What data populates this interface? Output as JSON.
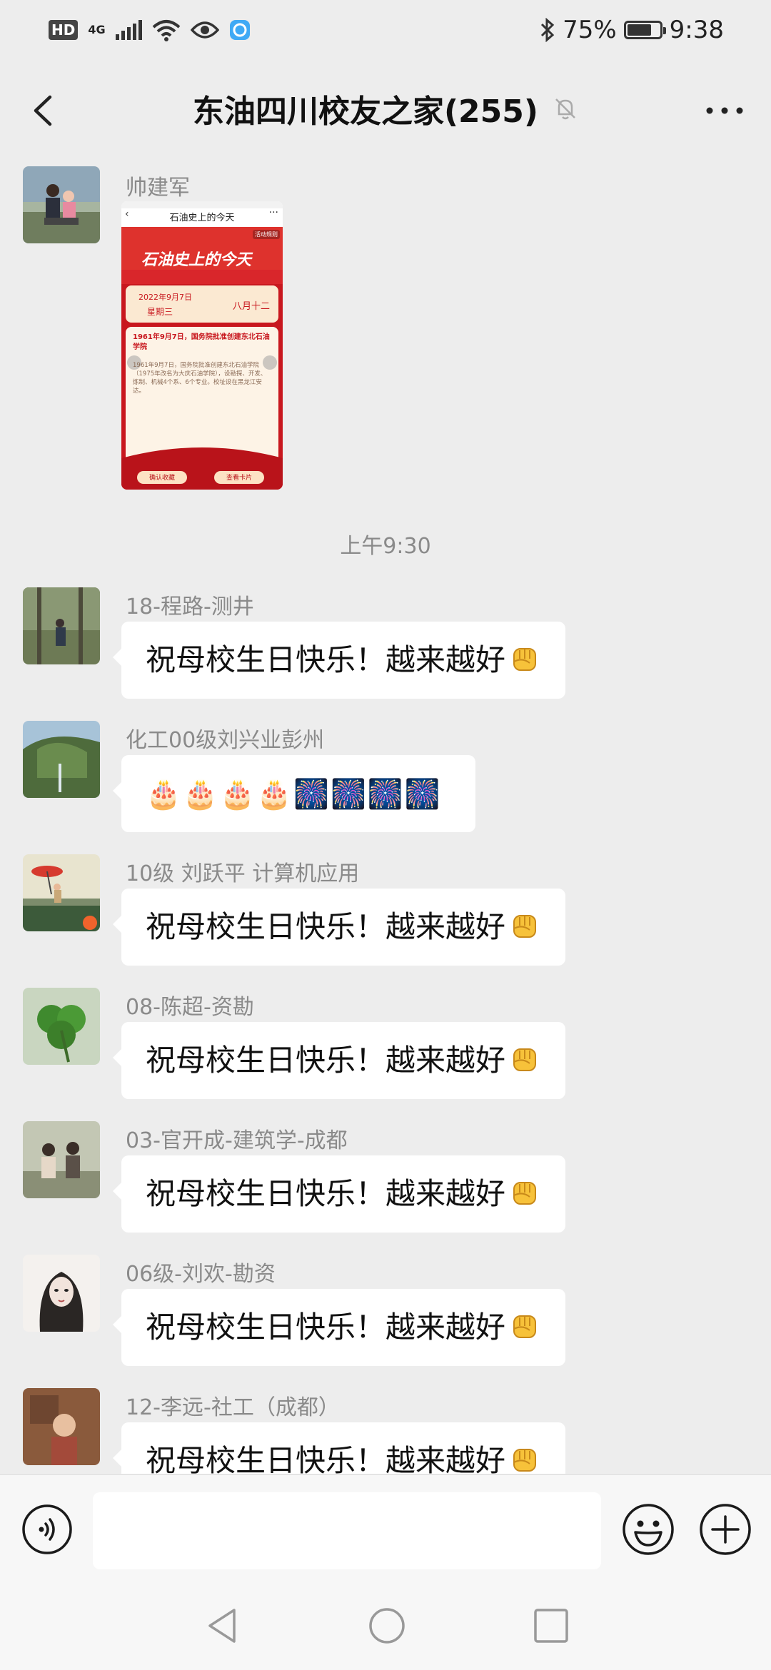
{
  "status_bar": {
    "hd": "HD",
    "network": "4G",
    "battery_percent": "75%",
    "battery_level": 0.75,
    "time": "9:38",
    "icons": [
      "hd-icon",
      "signal-icon",
      "wifi-icon",
      "eye-icon",
      "app-icon",
      "bluetooth-icon",
      "battery-icon"
    ]
  },
  "header": {
    "title": "东油四川校友之家(255)",
    "icons": [
      "back-icon",
      "mute-bell-icon",
      "more-icon"
    ]
  },
  "image_card": {
    "header_title": "石油史上的今天",
    "banner_title": "石油史上的今天",
    "tag": "活动规则",
    "date": "2022年9月7日",
    "weekday": "星期三",
    "lunar": "八月十二",
    "headline": "1961年9月7日，国务院批准创建东北石油学院",
    "body": "1961年9月7日，国务院批准创建东北石油学院（1975年改名为大庆石油学院），设勘探、开发、炼制、机械4个系、6个专业。校址设在黑龙江安达。",
    "button_left": "确认收藏",
    "button_right": "查看卡片"
  },
  "chat": {
    "first_sender": "帅建军",
    "time_divider": "上午9:30",
    "messages": [
      {
        "sender": "18-程路-测井",
        "text": "祝母校生日快乐！越来越好",
        "emoji": "fist-icon"
      },
      {
        "sender": "化工00级刘兴业彭州",
        "text": "🎂🎂🎂🎂🎆🎆🎆🎆"
      },
      {
        "sender": "10级 刘跃平 计算机应用",
        "text": "祝母校生日快乐！越来越好",
        "emoji": "fist-icon"
      },
      {
        "sender": "08-陈超-资勘",
        "text": "祝母校生日快乐！越来越好",
        "emoji": "fist-icon"
      },
      {
        "sender": "03-官开成-建筑学-成都",
        "text": "祝母校生日快乐！越来越好",
        "emoji": "fist-icon"
      },
      {
        "sender": "06级-刘欢-勘资",
        "text": "祝母校生日快乐！越来越好",
        "emoji": "fist-icon"
      },
      {
        "sender": "12-李远-社工（成都）",
        "text": "祝母校生日快乐！越来越好",
        "emoji": "fist-icon"
      }
    ]
  },
  "input_bar": {
    "value": "",
    "icons": [
      "voice-icon",
      "emoji-icon",
      "plus-icon"
    ]
  },
  "nav_bar": {
    "icons": [
      "nav-back-icon",
      "nav-home-icon",
      "nav-recent-icon"
    ]
  },
  "colors": {
    "background": "#ededed",
    "bubble": "#ffffff",
    "sender_text": "#8a8a8a",
    "card_red": "#c8171e"
  }
}
